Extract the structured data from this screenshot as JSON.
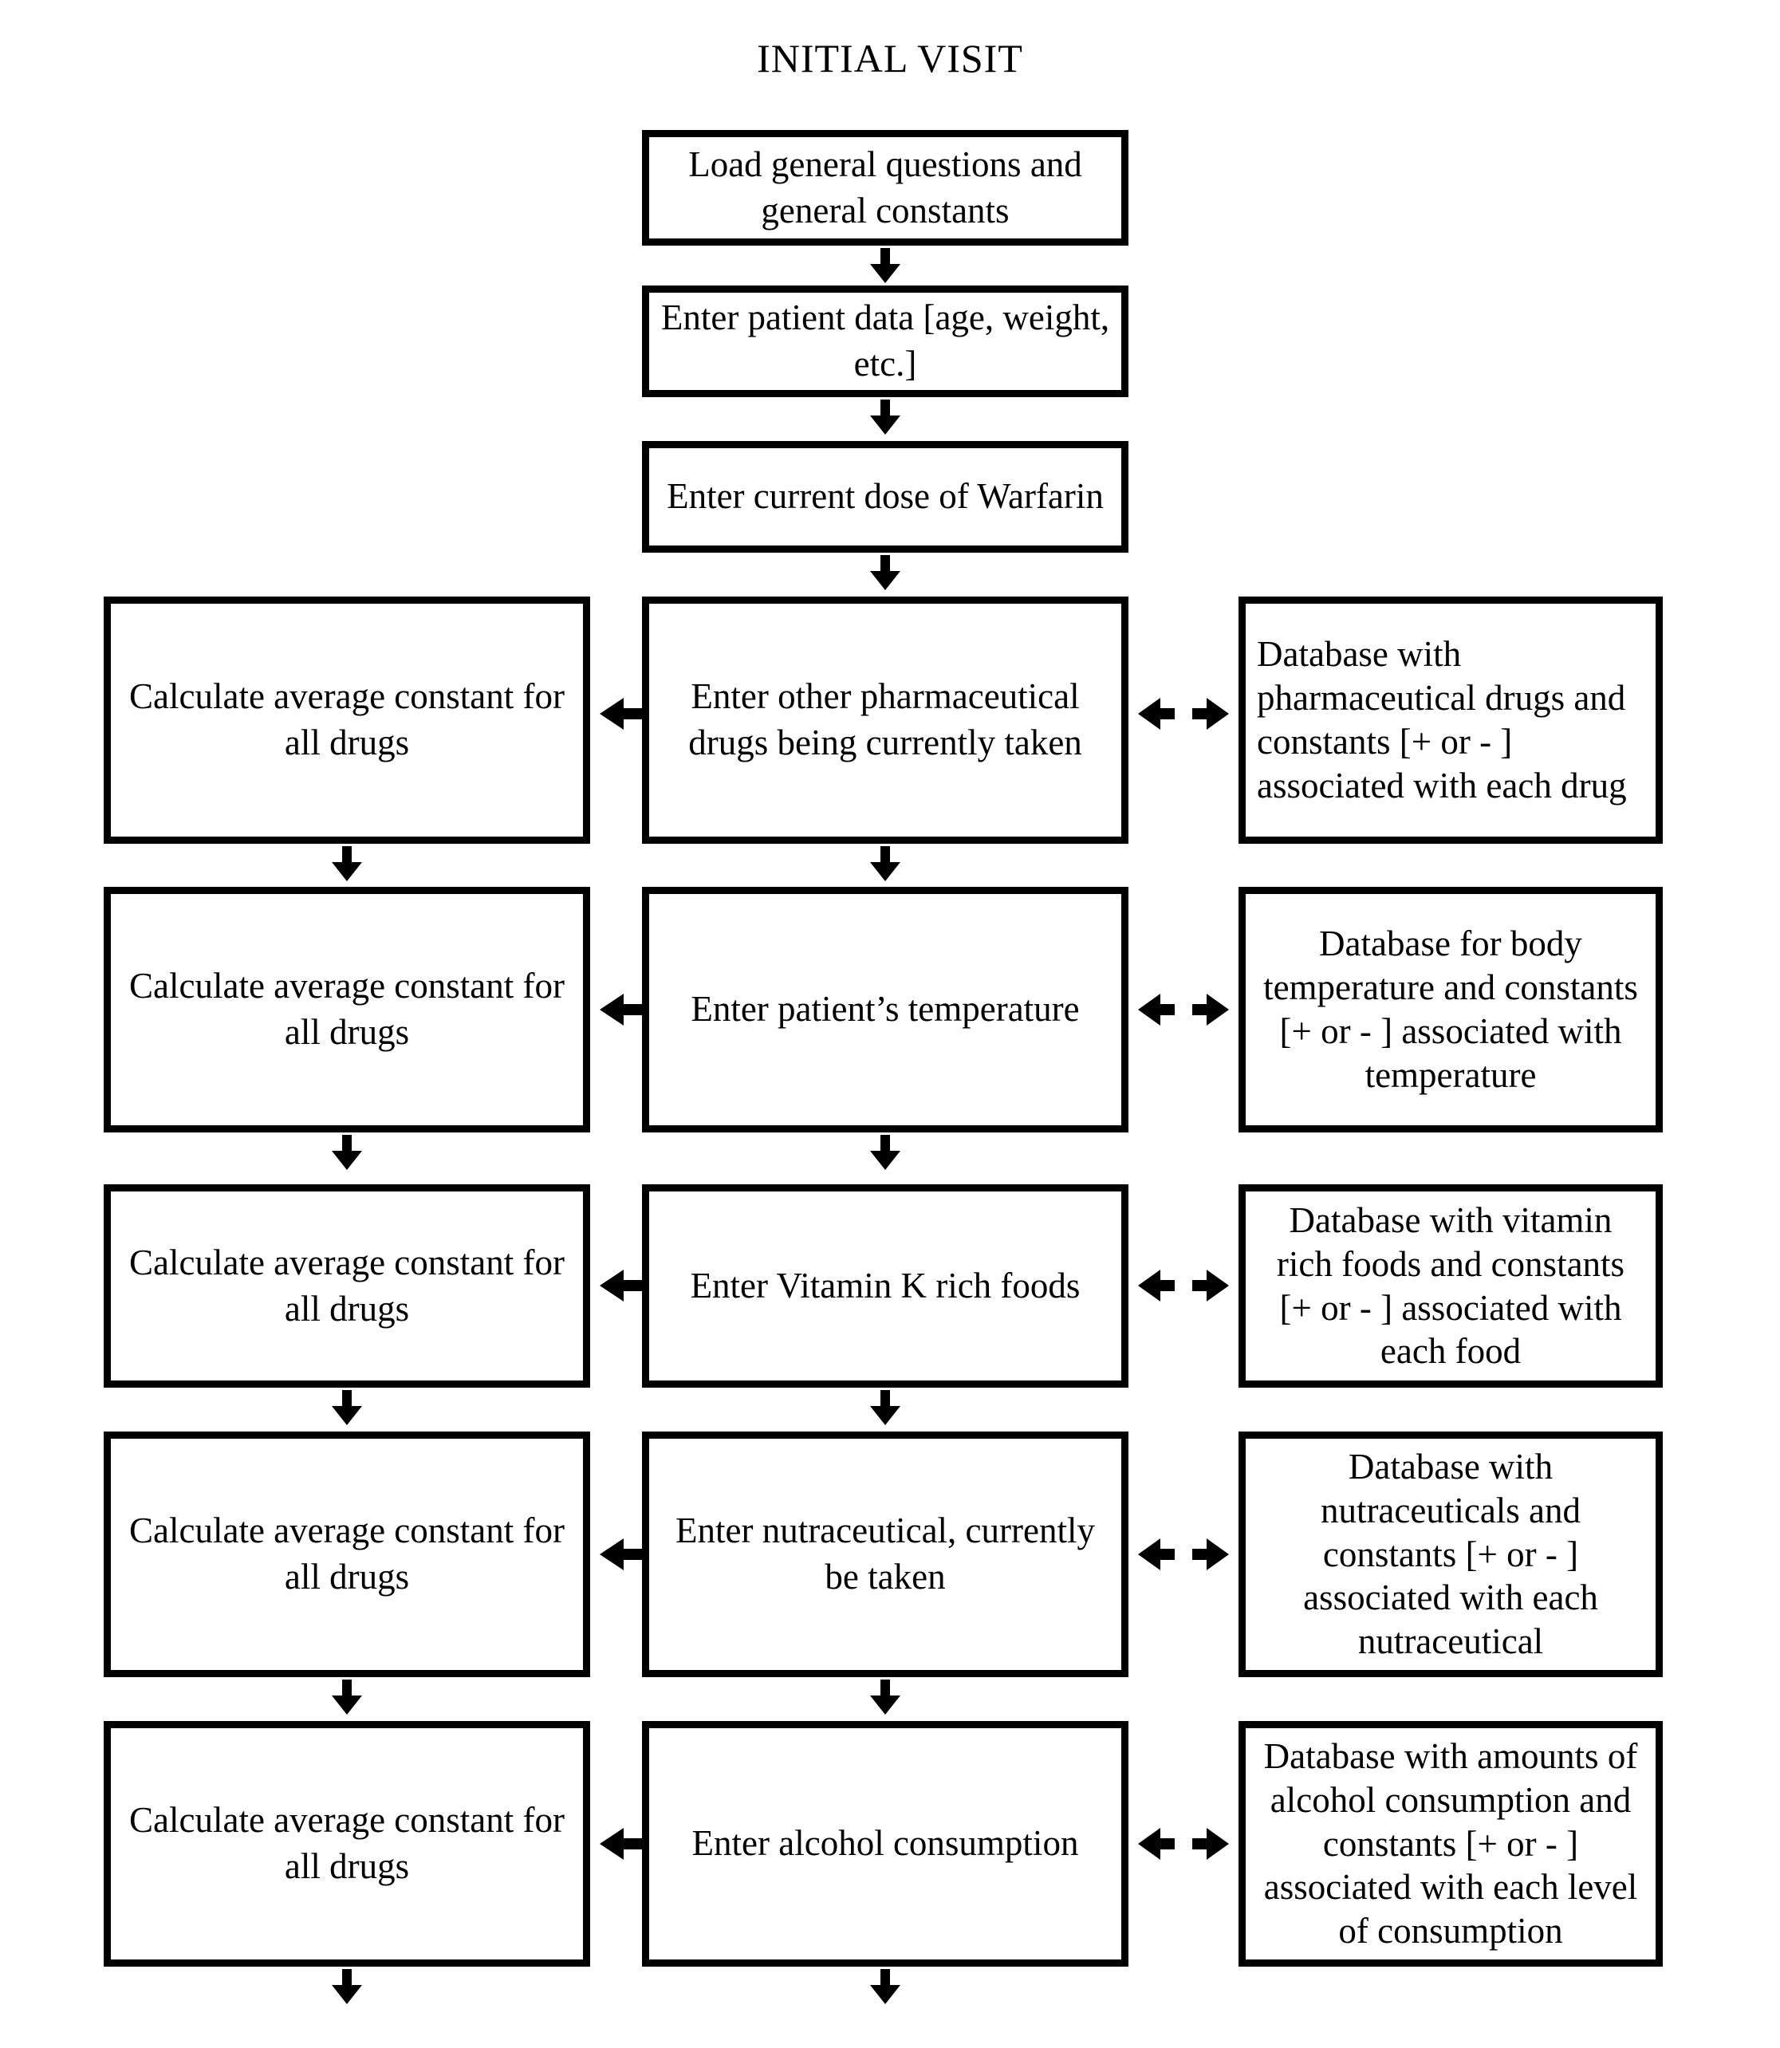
{
  "title": "INITIAL VISIT",
  "flow": {
    "top_sequence": [
      {
        "id": "load-general",
        "label": "Load general questions and general constants"
      },
      {
        "id": "enter-patient-data",
        "label": "Enter patient data [age, weight, etc.]"
      },
      {
        "id": "enter-current-dose",
        "label": "Enter current dose of Warfarin"
      }
    ],
    "rows": [
      {
        "id": "row-drugs",
        "calculate": "Calculate average constant for all drugs",
        "input": "Enter other pharmaceutical drugs being currently taken",
        "database": "Database with pharmaceutical drugs and constants [+ or - ] associated with each drug",
        "database_align": "left"
      },
      {
        "id": "row-temperature",
        "calculate": "Calculate average constant for all drugs",
        "input": "Enter patient’s temperature",
        "database": "Database for body temperature and constants [+ or - ] associated with temperature",
        "database_align": "center"
      },
      {
        "id": "row-vitamin-k",
        "calculate": "Calculate average constant for all drugs",
        "input": "Enter Vitamin K rich foods",
        "database": "Database with vitamin rich foods and constants [+ or - ] associated with each food",
        "database_align": "center"
      },
      {
        "id": "row-nutraceutical",
        "calculate": "Calculate average constant for all drugs",
        "input": "Enter nutraceutical, currently be taken",
        "database": "Database with nutraceuticals and constants [+ or - ] associated with each nutraceutical",
        "database_align": "center"
      },
      {
        "id": "row-alcohol",
        "calculate": "Calculate average constant for all drugs",
        "input": "Enter alcohol consumption",
        "database": "Database with amounts of alcohol consumption and constants [+ or - ] associated with each level of consumption",
        "database_align": "center"
      }
    ],
    "connectors": {
      "down_arrow": "down-arrow-icon",
      "left_arrow": "left-arrow-icon",
      "bidirectional_arrow": "left-right-arrow-icon"
    }
  },
  "colors": {
    "stroke": "#000000",
    "fill": "#ffffff",
    "text": "#000000"
  }
}
